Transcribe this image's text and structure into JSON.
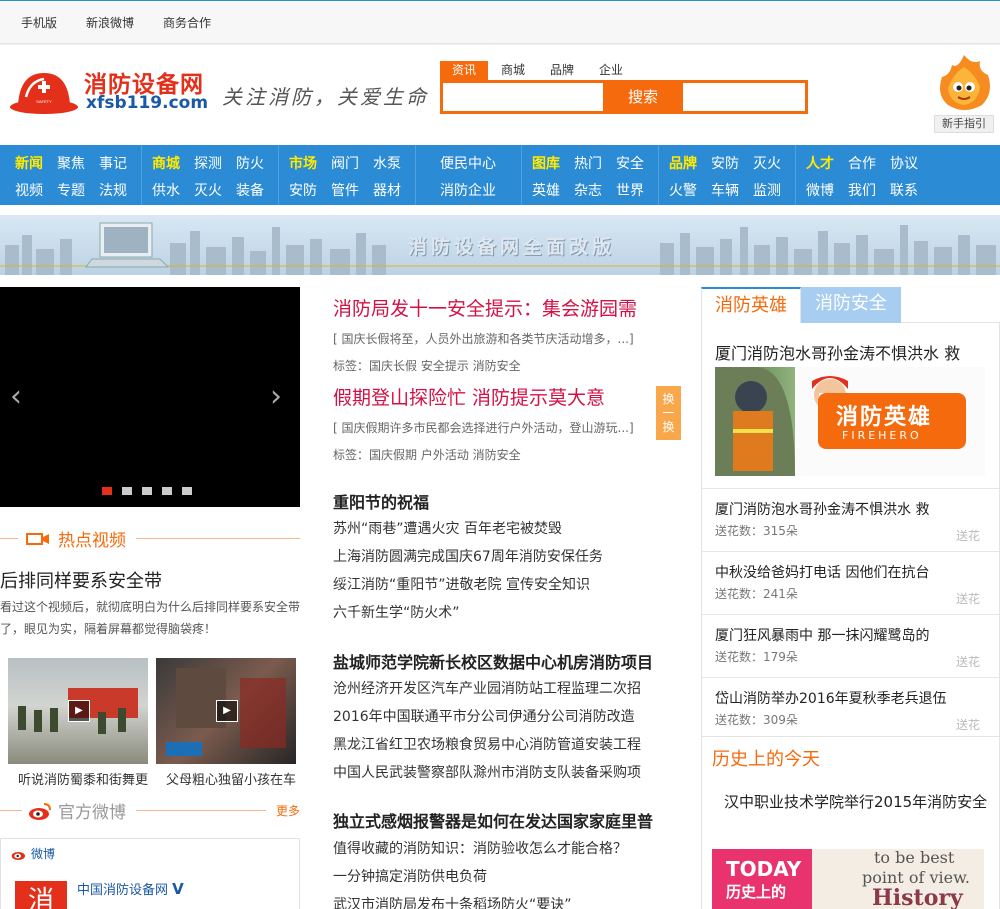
{
  "topbar": {
    "links": [
      "手机版",
      "新浪微博",
      "商务合作"
    ]
  },
  "logo": {
    "name": "消防设备网",
    "domain": "xfsb119.com"
  },
  "slogan": "关注消防，关爱生命",
  "search": {
    "tabs": [
      "资讯",
      "商城",
      "品牌",
      "企业"
    ],
    "active_tab": "资讯",
    "button": "搜索",
    "value": ""
  },
  "mascot": {
    "guide_label": "新手指引"
  },
  "nav": [
    {
      "items": [
        "新闻",
        "聚焦",
        "事记",
        "视频",
        "专题",
        "法规"
      ],
      "highlight": "新闻"
    },
    {
      "items": [
        "商城",
        "探测",
        "防火",
        "供水",
        "灭火",
        "装备"
      ],
      "highlight": "商城"
    },
    {
      "items": [
        "市场",
        "阀门",
        "水泵",
        "安防",
        "管件",
        "器材"
      ],
      "highlight": "市场"
    },
    {
      "items": [
        "便民中心",
        "消防企业"
      ],
      "highlight": ""
    },
    {
      "items": [
        "图库",
        "热门",
        "安全",
        "英雄",
        "杂志",
        "世界"
      ],
      "highlight": "图库"
    },
    {
      "items": [
        "品牌",
        "安防",
        "灭火",
        "火警",
        "车辆",
        "监测"
      ],
      "highlight": "品牌"
    },
    {
      "items": [
        "人才",
        "合作",
        "协议",
        "微博",
        "我们",
        "联系"
      ],
      "highlight": "人才"
    }
  ],
  "banner": {
    "text": "消防设备网全面改版"
  },
  "slider": {
    "slide_count": 5,
    "active": 1
  },
  "hot_video": {
    "section_title": "热点视频",
    "title": "后排同样要系安全带",
    "desc": "看过这个视频后，就彻底明白为什么后排同样要系安全带了，眼见为实，隔着屏幕都觉得脑袋疼！",
    "thumbs": [
      {
        "caption": "听说消防蜀黍和街舞更"
      },
      {
        "caption": "父母粗心独留小孩在车"
      }
    ]
  },
  "weibo": {
    "section_title": "官方微博",
    "more": "更多",
    "label": "微博",
    "account": "中国消防设备网"
  },
  "middle": {
    "top_news": [
      {
        "title": "消防局发十一安全提示：集会游园需",
        "summary": "[ 国庆长假将至，人员外出旅游和各类节庆活动增多，...]",
        "tags": "标签：国庆长假 安全提示 消防安全"
      },
      {
        "title": "假期登山探险忙 消防提示莫大意",
        "summary": "[ 国庆假期许多市民都会选择进行户外活动，登山游玩...]",
        "tags": "标签：国庆假期 户外活动 消防安全"
      }
    ],
    "swap_label": "换一换",
    "groups": [
      {
        "heading": "重阳节的祝福",
        "items": [
          "苏州“雨巷”遭遇火灾 百年老宅被焚毁",
          "上海消防圆满完成国庆67周年消防安保任务",
          "绥江消防“重阳节”进敬老院 宣传安全知识",
          "六千新生学“防火术”"
        ]
      },
      {
        "heading": "盐城师范学院新长校区数据中心机房消防项目",
        "items": [
          "沧州经济开发区汽车产业园消防站工程监理二次招",
          "2016年中国联通平市分公司伊通分公司消防改造",
          "黑龙江省红卫农场粮食贸易中心消防管道安装工程",
          "中国人民武装警察部队滁州市消防支队装备采购项"
        ]
      },
      {
        "heading": "独立式感烟报警器是如何在发达国家家庭里普",
        "items": [
          "值得收藏的消防知识：消防验收怎么才能合格？",
          "一分钟搞定消防供电负荷",
          "武汉市消防局发布十条稻场防火“要诀”"
        ]
      }
    ]
  },
  "right": {
    "tabs": [
      "消防英雄",
      "消防安全"
    ],
    "main_title": "厦门消防泡水哥孙金涛不惧洪水 救",
    "hero_badge": {
      "title": "消防英雄",
      "sub": "FIREHERO"
    },
    "items": [
      {
        "title": "厦门消防泡水哥孙金涛不惧洪水 救",
        "flowers": "送花数：315朵",
        "send": "送花"
      },
      {
        "title": "中秋没给爸妈打电话 因他们在抗台",
        "flowers": "送花数：241朵",
        "send": "送花"
      },
      {
        "title": "厦门狂风暴雨中 那一抹闪耀鹭岛的",
        "flowers": "送花数：179朵",
        "send": "送花"
      },
      {
        "title": "岱山消防举办2016年夏秋季老兵退伍",
        "flowers": "送花数：309朵",
        "send": "送花"
      }
    ],
    "history": {
      "heading": "历史上的今天",
      "text": "汉中职业技术学院举行2015年消防安全",
      "img_text1": "TODAY",
      "img_text2": "历史上的"
    }
  },
  "colors": {
    "accent": "#f56a0d",
    "nav_blue": "#2b8bd4",
    "headline": "#d31145"
  }
}
